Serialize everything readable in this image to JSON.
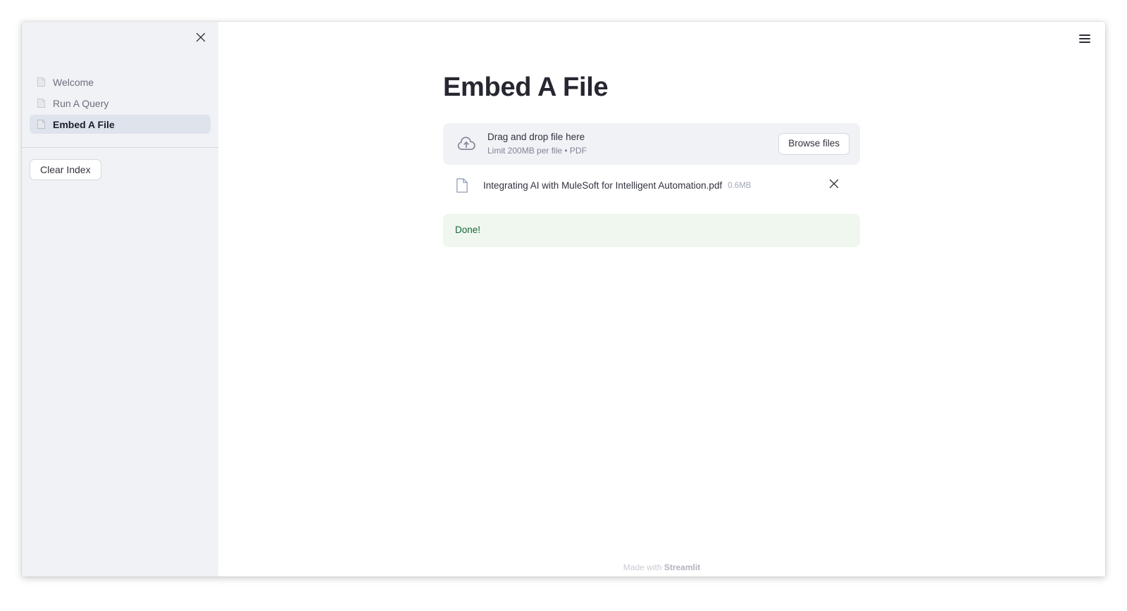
{
  "window": {
    "sidebar": {
      "close_icon": "close-icon",
      "nav_items": [
        {
          "icon": "page-icon",
          "label": "Welcome",
          "active": false
        },
        {
          "icon": "page-icon",
          "label": "Run A Query",
          "active": false
        },
        {
          "icon": "page-icon",
          "label": "Embed A File",
          "active": true
        }
      ],
      "clear_index_label": "Clear Index"
    },
    "main": {
      "menu_icon": "hamburger-menu-icon",
      "page_title": "Embed A File",
      "uploader": {
        "icon": "cloud-upload-icon",
        "drag_text": "Drag and drop file here",
        "limit_text": "Limit 200MB per file • PDF",
        "browse_label": "Browse files"
      },
      "uploaded_file": {
        "icon": "file-icon",
        "name": "Integrating AI with MuleSoft for Intelligent Automation.pdf",
        "size": "0.6MB",
        "remove_icon": "close-icon"
      },
      "status": {
        "text": "Done!",
        "color": "#17663a",
        "background": "#eff7ee"
      },
      "footer": {
        "prefix": "Made with ",
        "brand": "Streamlit"
      }
    }
  },
  "colors": {
    "sidebar_bg": "#f0f2f6",
    "active_nav_bg": "#dfe3ec",
    "title": "#262730",
    "accent_gray": "#808495"
  }
}
